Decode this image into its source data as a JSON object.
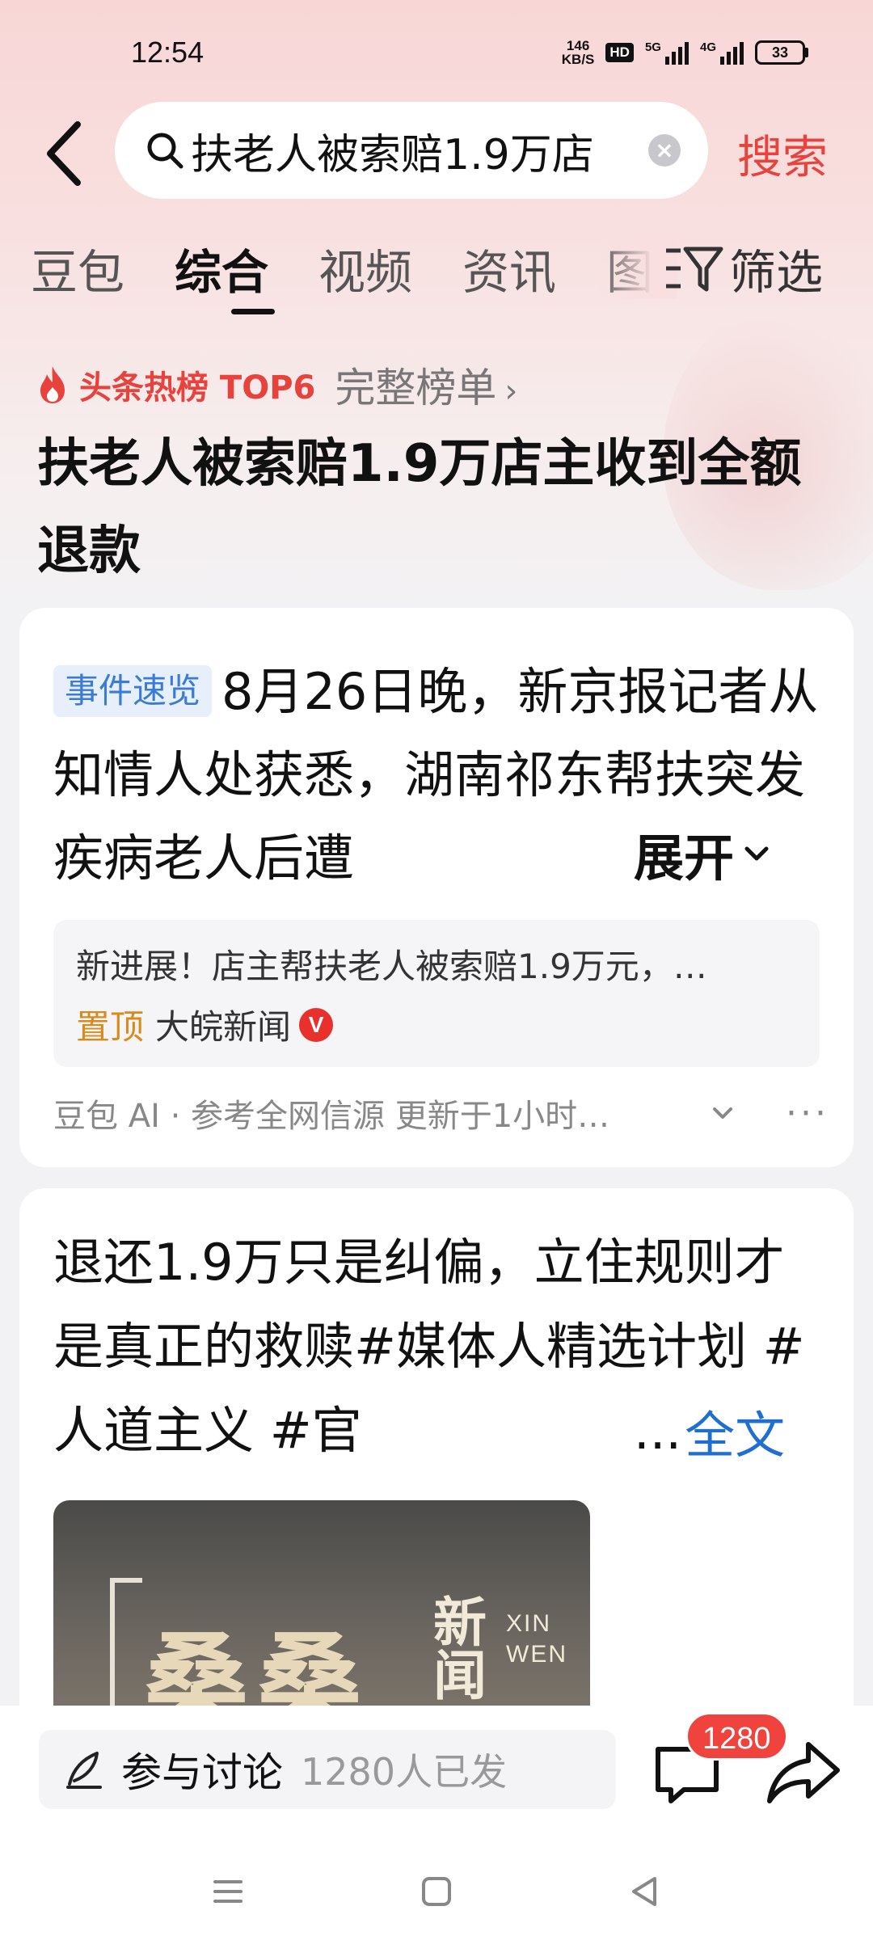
{
  "status_bar": {
    "time": "12:54",
    "net_speed_value": "146",
    "net_speed_unit": "KB/S",
    "hd_label": "HD",
    "signal1_label": "5G",
    "signal2_label": "4G",
    "battery": "33"
  },
  "search": {
    "query": "扶老人被索赔1.9万店",
    "button_label": "搜索"
  },
  "tabs": [
    {
      "label": "豆包"
    },
    {
      "label": "综合"
    },
    {
      "label": "视频"
    },
    {
      "label": "资讯"
    },
    {
      "label": "图"
    }
  ],
  "filter_label": "筛选",
  "hot": {
    "label": "头条热榜 TOP6",
    "rank_link": "完整榜单",
    "chevron": "›",
    "headline": "扶老人被索赔1.9万店主收到全额退款"
  },
  "card1": {
    "tag": "事件速览",
    "summary": "8月26日晚，新京报记者从知情人处获悉，湖南祁东帮扶突发疾病老人后遭",
    "expand_label": "展开",
    "update_text": "新进展！店主帮扶老人被索赔1.9万元，…",
    "pin_label": "置顶",
    "source": "大皖新闻",
    "verify_mark": "V",
    "ai_line": "豆包 AI · 参考全网信源 更新于1小时…",
    "more": "···"
  },
  "card2": {
    "text": "退还1.9万只是纠偏，立住规则才是真正的救赎#媒体人精选计划 #人道主义 #官",
    "ellipsis": "...",
    "fulltext_label": "全文",
    "image": {
      "title": "桑桑",
      "sub1": "新",
      "sub2": "闻",
      "latin1": "XIN",
      "latin2": "WEN"
    }
  },
  "bottom": {
    "discuss_label": "参与讨论",
    "discuss_count": "1280人已发",
    "comment_badge": "1280"
  },
  "colors": {
    "accent_red": "#e8423d",
    "link_blue": "#1e6fd0",
    "tag_blue": "#3a7bd5",
    "pin_orange": "#d98a1a"
  },
  "icons": [
    "back-arrow-icon",
    "search-icon",
    "clear-icon",
    "filter-icon",
    "flame-icon",
    "chevron-down-icon",
    "pen-icon",
    "comment-icon",
    "share-icon",
    "menu-icon",
    "home-icon",
    "back-triangle-icon"
  ]
}
